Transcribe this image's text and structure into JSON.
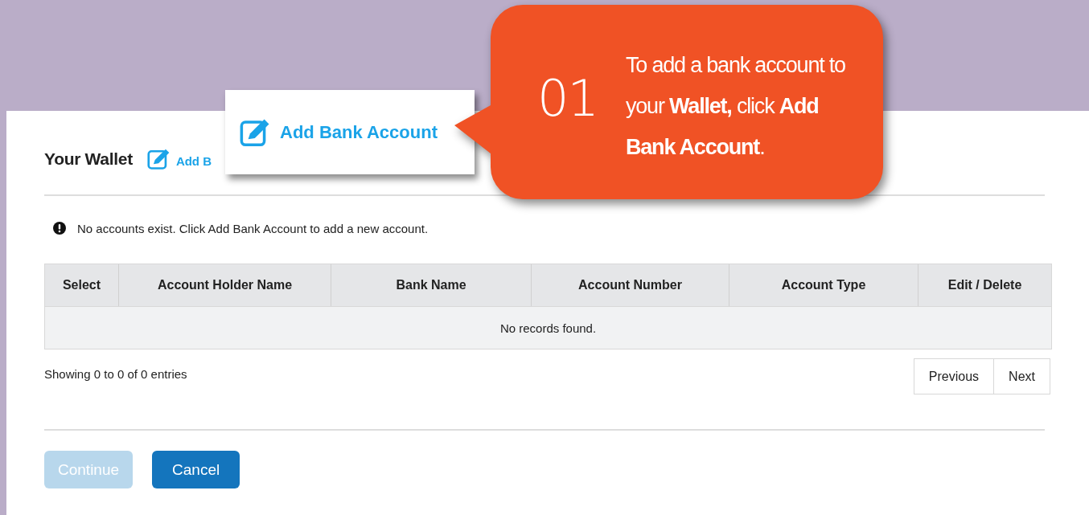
{
  "page": {
    "title": "Your Wallet",
    "add_link": "Add B"
  },
  "notice": "No accounts exist. Click Add Bank Account to add a new account.",
  "table": {
    "columns": [
      "Select",
      "Account Holder Name",
      "Bank Name",
      "Account Number",
      "Account Type",
      "Edit / Delete"
    ],
    "empty_message": "No records found."
  },
  "footer": {
    "summary": "Showing 0 to 0 of 0 entries",
    "pagination": [
      "Previous",
      "Next"
    ]
  },
  "buttons": [
    {
      "label": "Continue",
      "disabled": true
    },
    {
      "label": "Cancel",
      "disabled": false
    }
  ],
  "zoom_callout": {
    "label": "Add Bank Account"
  },
  "tip": {
    "step": "01",
    "text": "To add a bank account to your **Wallet,** click **Add Bank Account**."
  }
}
